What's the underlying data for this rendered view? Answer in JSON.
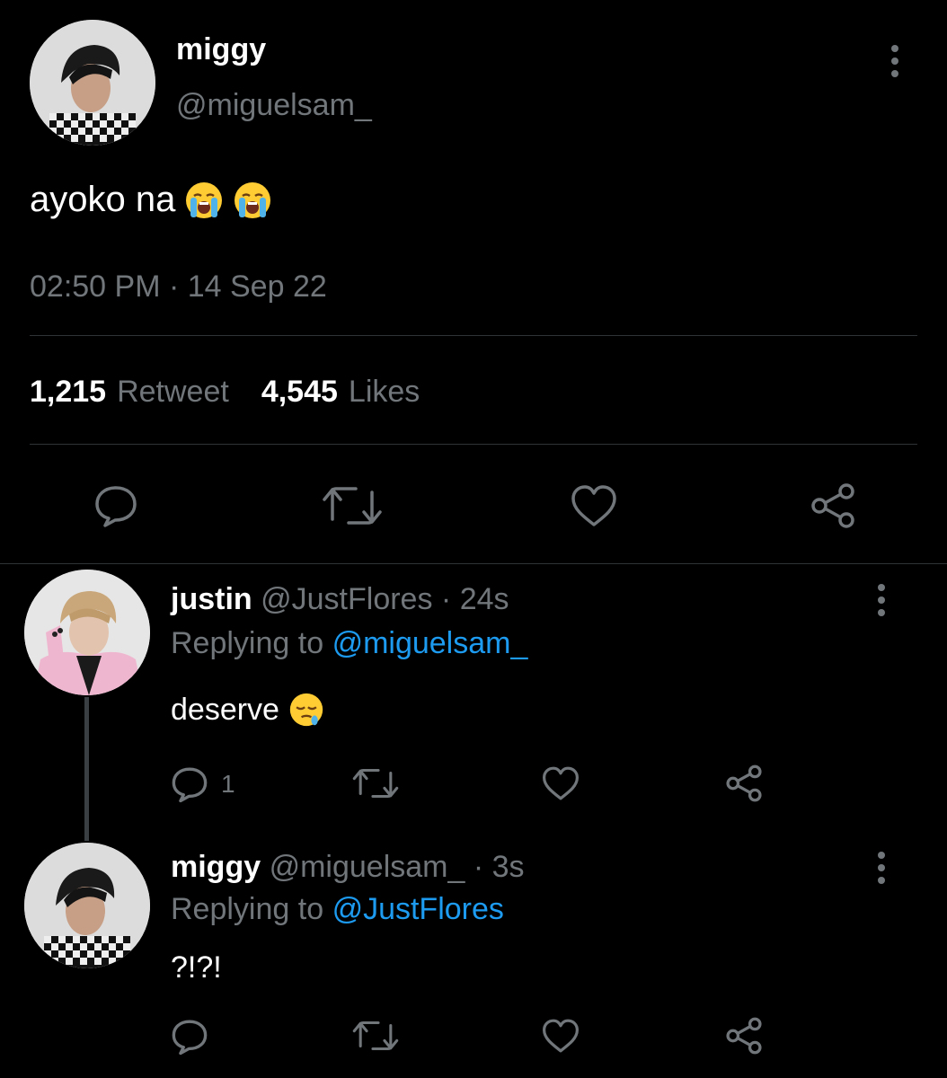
{
  "main_tweet": {
    "display_name": "miggy",
    "handle": "@miguelsam_",
    "text": "ayoko na",
    "emojis": [
      "loudly-crying-face",
      "loudly-crying-face"
    ],
    "timestamp": "02:50 PM · 14 Sep 22",
    "retweet_count": "1,215",
    "retweet_label": "Retweet",
    "likes_count": "4,545",
    "likes_label": "Likes"
  },
  "replies": [
    {
      "display_name": "justin",
      "handle": "@JustFlores",
      "separator": "·",
      "time": "24s",
      "replying_prefix": "Replying to",
      "replying_to": "@miguelsam_",
      "text": "deserve",
      "emoji": "sleepy-face",
      "reply_count": "1"
    },
    {
      "display_name": "miggy",
      "handle": "@miguelsam_",
      "separator": "·",
      "time": "3s",
      "replying_prefix": "Replying to",
      "replying_to": "@JustFlores",
      "text": "?!?!"
    }
  ],
  "icons": {
    "reply": "reply-icon",
    "retweet": "retweet-icon",
    "like": "heart-icon",
    "share": "share-icon",
    "more": "more-vertical-icon"
  },
  "colors": {
    "background": "#000000",
    "text": "#ffffff",
    "secondary": "#71767b",
    "mention": "#1d9bf0",
    "divider": "#2f3336"
  }
}
